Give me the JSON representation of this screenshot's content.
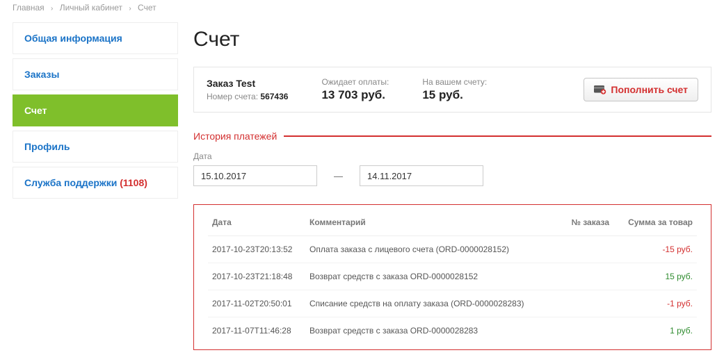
{
  "breadcrumb": {
    "home": "Главная",
    "cabinet": "Личный кабинет",
    "account": "Счет"
  },
  "sidebar": {
    "items": [
      {
        "label": "Общая информация"
      },
      {
        "label": "Заказы"
      },
      {
        "label": "Счет"
      },
      {
        "label": "Профиль"
      },
      {
        "label": "Служба поддержки",
        "count": "(1108)"
      }
    ]
  },
  "page_title": "Счет",
  "summary": {
    "order_label": "Заказ Test",
    "acct_prefix": "Номер счета:",
    "acct_no": "567436",
    "pending_label": "Ожидает оплаты:",
    "pending_value": "13 703 руб.",
    "balance_label": "На вашем счету:",
    "balance_value": "15 руб.",
    "topup_label": "Пополнить счет"
  },
  "history_title": "История платежей",
  "date": {
    "label": "Дата",
    "from": "15.10.2017",
    "to": "14.11.2017"
  },
  "table": {
    "headers": {
      "date": "Дата",
      "comment": "Комментарий",
      "order": "№ заказа",
      "sum": "Сумма за товар"
    },
    "rows": [
      {
        "date": "2017-10-23T20:13:52",
        "comment": "Оплата заказа с лицевого счета (ORD-0000028152)",
        "order": "",
        "sum": "-15 руб.",
        "neg": true
      },
      {
        "date": "2017-10-23T21:18:48",
        "comment": "Возврат средств с заказа ORD-0000028152",
        "order": "",
        "sum": "15 руб.",
        "neg": false
      },
      {
        "date": "2017-11-02T20:50:01",
        "comment": "Списание средств на оплату заказа (ORD-0000028283)",
        "order": "",
        "sum": "-1 руб.",
        "neg": true
      },
      {
        "date": "2017-11-07T11:46:28",
        "comment": "Возврат средств с заказа ORD-0000028283",
        "order": "",
        "sum": "1 руб.",
        "neg": false
      }
    ]
  }
}
